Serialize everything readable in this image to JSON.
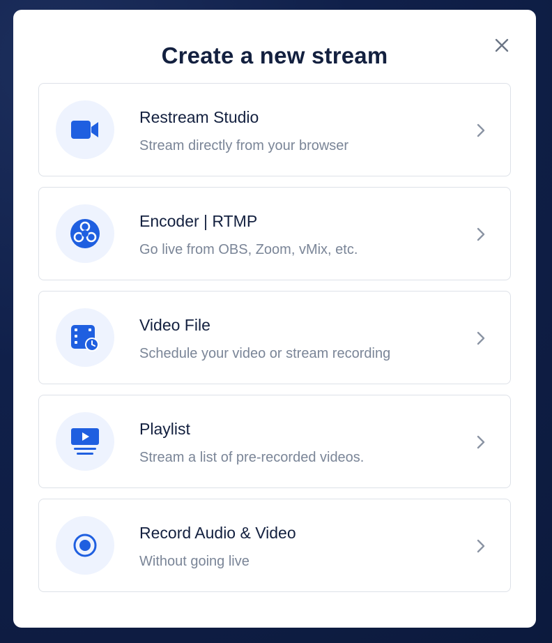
{
  "modal": {
    "title": "Create a new stream",
    "close_icon": "close-icon"
  },
  "options": [
    {
      "title": "Restream Studio",
      "description": "Stream directly from your browser",
      "icon": "video-camera-icon"
    },
    {
      "title": "Encoder | RTMP",
      "description": "Go live from OBS, Zoom, vMix, etc.",
      "icon": "obs-icon"
    },
    {
      "title": "Video File",
      "description": "Schedule your video or stream recording",
      "icon": "video-file-schedule-icon"
    },
    {
      "title": "Playlist",
      "description": "Stream a list of pre-recorded videos.",
      "icon": "playlist-icon"
    },
    {
      "title": "Record Audio & Video",
      "description": "Without going live",
      "icon": "record-icon"
    }
  ],
  "colors": {
    "accent": "#1f5fe0",
    "icon_bg": "#eef3fe",
    "title": "#13203f",
    "description": "#7a8597",
    "chevron": "#8a93a3",
    "border": "#dde1e8"
  }
}
